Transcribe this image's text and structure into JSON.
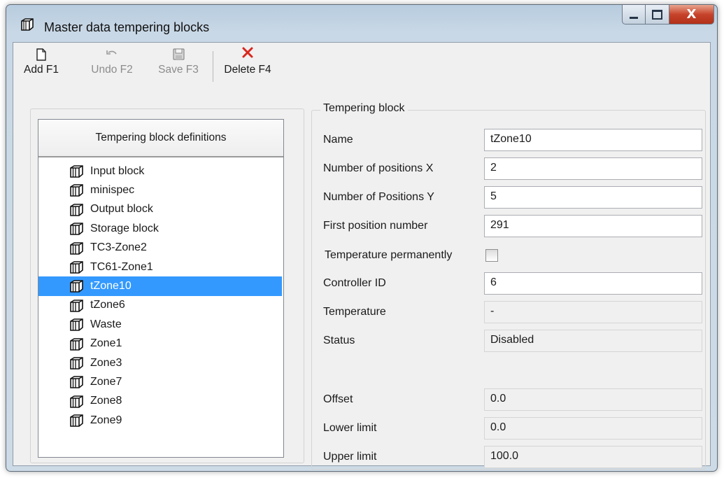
{
  "window": {
    "title": "Master data tempering blocks",
    "icon": "block-icon",
    "controls": {
      "minimize": "minimize",
      "maximize": "maximize",
      "close": "X"
    }
  },
  "toolbar": {
    "add_label": "Add F1",
    "undo_label": "Undo F2",
    "save_label": "Save F3",
    "delete_label": "Delete F4"
  },
  "list": {
    "header": "Tempering block definitions",
    "selected_index": 6,
    "items": [
      "Input block",
      "minispec",
      "Output block",
      "Storage block",
      "TC3-Zone2",
      "TC61-Zone1",
      "tZone10",
      "tZone6",
      "Waste",
      "Zone1",
      "Zone3",
      "Zone7",
      "Zone8",
      "Zone9"
    ]
  },
  "details": {
    "group_title": "Tempering block",
    "name": {
      "label": "Name",
      "value": "tZone10"
    },
    "pos_x": {
      "label": "Number of positions X",
      "value": "2"
    },
    "pos_y": {
      "label": "Number of Positions Y",
      "value": "5"
    },
    "first_pos": {
      "label": "First position number",
      "value": "291"
    },
    "temp_permanent": {
      "label": "Temperature permanently",
      "checked": false
    },
    "controller_id": {
      "label": "Controller ID",
      "value": "6"
    },
    "temperature": {
      "label": "Temperature",
      "value": "-"
    },
    "status": {
      "label": "Status",
      "value": "Disabled"
    },
    "offset": {
      "label": "Offset",
      "value": "0.0"
    },
    "lower_limit": {
      "label": "Lower limit",
      "value": "0.0"
    },
    "upper_limit": {
      "label": "Upper limit",
      "value": "100.0"
    }
  },
  "colors": {
    "selection": "#3399ff",
    "delete_icon": "#d9261c",
    "close_button": "#c7442b"
  }
}
